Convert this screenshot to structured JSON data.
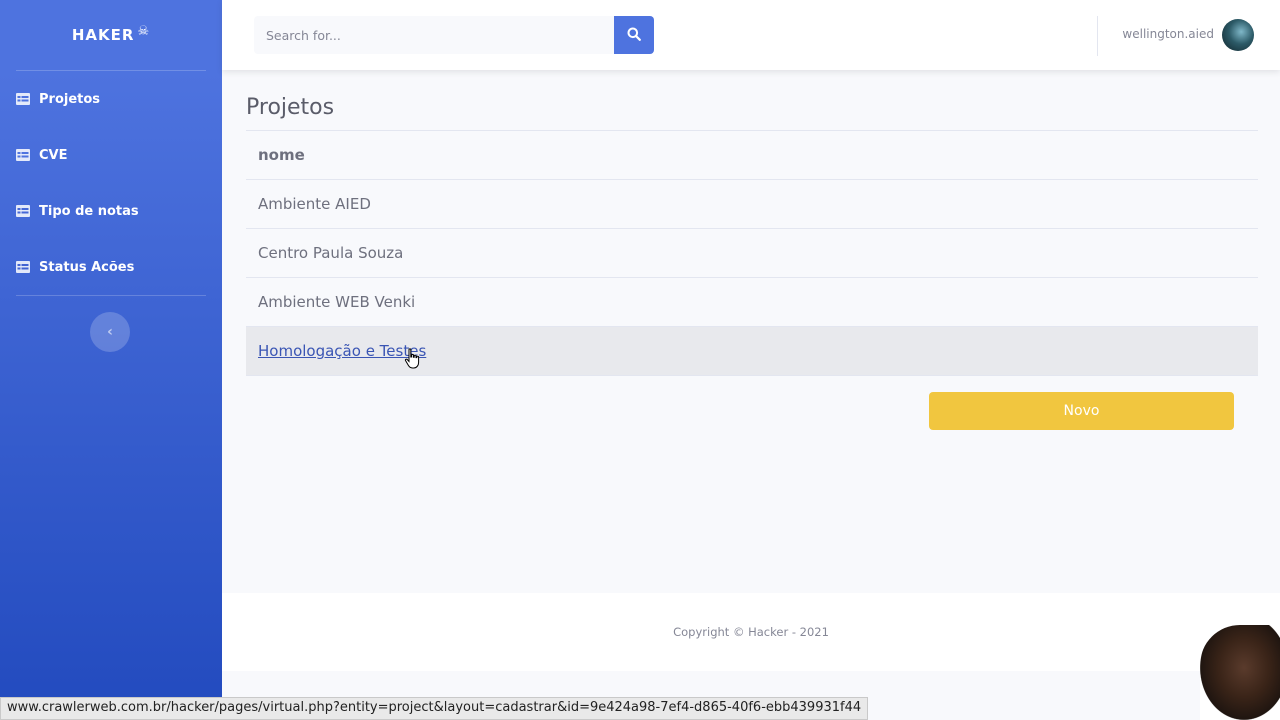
{
  "brand": {
    "name": "HAKER",
    "logo_glyph": "☠"
  },
  "sidebar": {
    "items": [
      {
        "label": "Projetos",
        "icon": "table-icon"
      },
      {
        "label": "CVE",
        "icon": "table-icon"
      },
      {
        "label": "Tipo de notas",
        "icon": "table-icon"
      },
      {
        "label": "Status Acões",
        "icon": "table-icon"
      }
    ],
    "collapse_glyph": "‹"
  },
  "topbar": {
    "search_placeholder": "Search for...",
    "username": "wellington.aied"
  },
  "main": {
    "title": "Projetos",
    "table": {
      "header": "nome",
      "rows": [
        "Ambiente AIED",
        "Centro Paula Souza",
        "Ambiente WEB Venki",
        "Homologação e Testes"
      ]
    },
    "new_button": "Novo"
  },
  "footer": {
    "copyright": "Copyright © Hacker - 2021"
  },
  "statusbar": {
    "url": "www.crawlerweb.com.br/hacker/pages/virtual.php?entity=project&layout=cadastrar&id=9e424a98-7ef4-d865-40f6-ebb439931f44"
  },
  "colors": {
    "primary": "#4e73df",
    "warning": "#f1c63f"
  }
}
